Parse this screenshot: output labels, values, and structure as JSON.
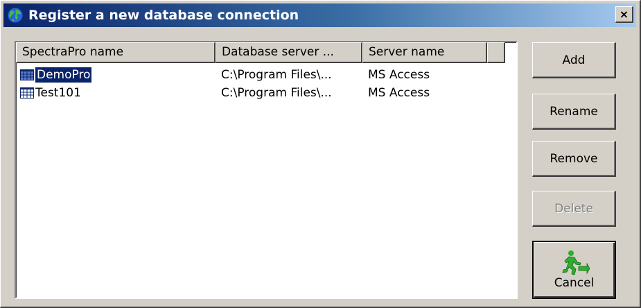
{
  "window": {
    "title": "Register a new database connection",
    "close_label": "×"
  },
  "list": {
    "columns": [
      "SpectraPro name",
      "Database server ...",
      "Server name",
      ""
    ],
    "rows": [
      {
        "name": "DemoPro",
        "server": "C:\\Program Files\\...",
        "server_name": "MS Access",
        "selected": true
      },
      {
        "name": "Test101",
        "server": "C:\\Program Files\\...",
        "server_name": "MS Access",
        "selected": false
      }
    ]
  },
  "buttons": {
    "add": "Add",
    "rename": "Rename",
    "remove": "Remove",
    "delete": "Delete",
    "cancel": "Cancel"
  },
  "colors": {
    "titlebar_start": "#0a246a",
    "titlebar_end": "#a6caf0",
    "selection": "#0a246a",
    "face": "#d4d0c8"
  },
  "icons": {
    "title": "globe-icon",
    "row": "table-grid-icon",
    "cancel": "running-exit-icon"
  }
}
